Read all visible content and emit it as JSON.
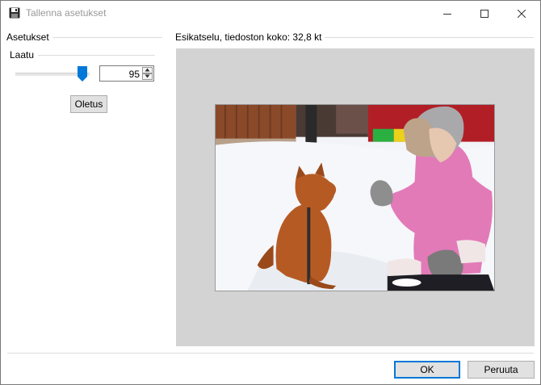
{
  "window": {
    "title": "Tallenna asetukset",
    "icon": "floppy-disk-icon"
  },
  "settings": {
    "group_label": "Asetukset",
    "quality_label": "Laatu",
    "quality_value": "95",
    "quality_level": 0.95,
    "default_button": "Oletus"
  },
  "preview": {
    "label": "Esikatselu, tiedoston koko: 32,8 kt"
  },
  "footer": {
    "ok": "OK",
    "cancel": "Peruuta"
  },
  "colors": {
    "accent": "#0078d7",
    "preview_bg": "#d3d3d3"
  }
}
